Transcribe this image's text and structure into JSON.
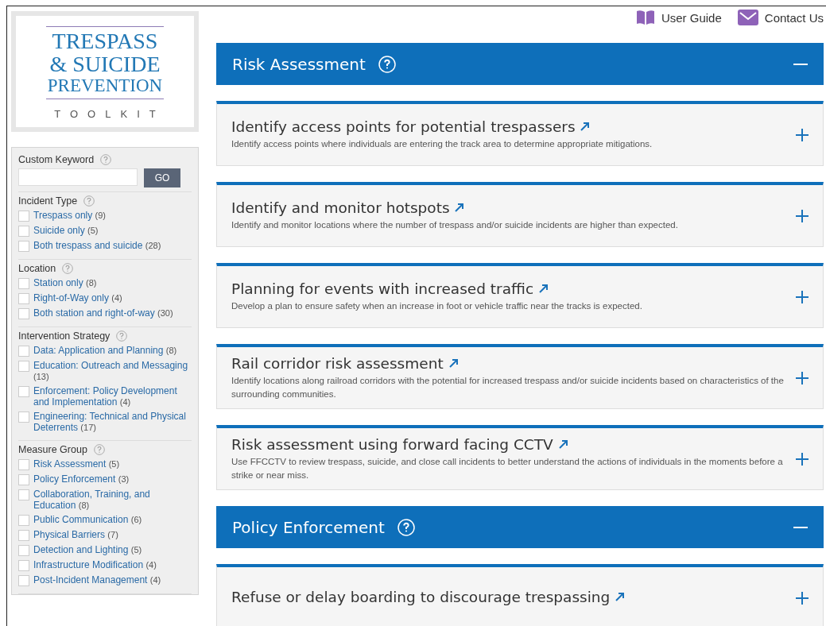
{
  "logo": {
    "lines": [
      "TRESPASS",
      "& SUICIDE",
      "PREVENTION"
    ],
    "subtitle": "TOOLKIT"
  },
  "top_links": [
    {
      "kind": "guide",
      "label": "User Guide"
    },
    {
      "kind": "contact",
      "label": "Contact Us"
    }
  ],
  "keyword": {
    "label": "Custom Keyword",
    "button": "GO"
  },
  "filters": [
    {
      "title": "Incident Type",
      "options": [
        {
          "label": "Trespass only",
          "count": "(9)",
          "checked": false
        },
        {
          "label": "Suicide only",
          "count": "(5)",
          "checked": false
        },
        {
          "label": "Both trespass and suicide",
          "count": "(28)",
          "checked": false
        }
      ]
    },
    {
      "title": "Location",
      "options": [
        {
          "label": "Station only",
          "count": "(8)",
          "checked": false
        },
        {
          "label": "Right-of-Way only",
          "count": "(4)",
          "checked": false
        },
        {
          "label": "Both station and right-of-way",
          "count": "(30)",
          "checked": false
        }
      ]
    },
    {
      "title": "Intervention Strategy",
      "options": [
        {
          "label": "Data: Application and Planning",
          "count": "(8)",
          "checked": false
        },
        {
          "label": "Education: Outreach and Messaging",
          "count": "(13)",
          "checked": false
        },
        {
          "label": "Enforcement: Policy Development and Implementation",
          "count": "(4)",
          "checked": false
        },
        {
          "label": "Engineering: Technical and Physical Deterrents",
          "count": "(17)",
          "checked": false
        }
      ]
    },
    {
      "title": "Measure Group",
      "options": [
        {
          "label": "Risk Assessment",
          "count": "(5)",
          "checked": false
        },
        {
          "label": "Policy Enforcement",
          "count": "(3)",
          "checked": false
        },
        {
          "label": "Collaboration, Training, and Education",
          "count": "(8)",
          "checked": false
        },
        {
          "label": "Public Communication",
          "count": "(6)",
          "checked": false
        },
        {
          "label": "Physical Barriers",
          "count": "(7)",
          "checked": false
        },
        {
          "label": "Detection and Lighting",
          "count": "(5)",
          "checked": false
        },
        {
          "label": "Infrastructure Modification",
          "count": "(4)",
          "checked": false
        },
        {
          "label": "Post-Incident Management",
          "count": "(4)",
          "checked": false
        }
      ]
    }
  ],
  "sections": [
    {
      "title": "Risk Assessment",
      "expanded": true,
      "items": [
        {
          "title": "Identify access points for potential trespassers",
          "description": "Identify access points where individuals are entering the track area to determine appropriate mitigations.",
          "expanded": false
        },
        {
          "title": "Identify and monitor hotspots",
          "description": "Identify and monitor locations where the number of trespass and/or suicide incidents are higher than expected.",
          "expanded": false
        },
        {
          "title": "Planning for events with increased traffic",
          "description": "Develop a plan to ensure safety when an increase in foot or vehicle traffic near the tracks is expected.",
          "expanded": false
        },
        {
          "title": "Rail corridor risk assessment",
          "description": "Identify locations along railroad corridors with the potential for increased trespass and/or suicide incidents based on characteristics of the surrounding communities.",
          "expanded": false
        },
        {
          "title": "Risk assessment using forward facing CCTV",
          "description": "Use FFCCTV to review trespass, suicide, and close call incidents to better understand the actions of individuals in the moments before a strike or near miss.",
          "expanded": false
        }
      ]
    },
    {
      "title": "Policy Enforcement",
      "expanded": true,
      "items": [
        {
          "title": "Refuse or delay boarding to discourage trespassing",
          "expanded": false
        }
      ]
    }
  ]
}
